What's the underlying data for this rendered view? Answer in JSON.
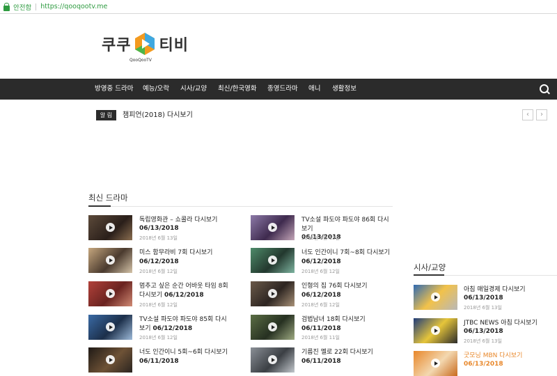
{
  "browser": {
    "secure_label": "안전함",
    "url": "https://qooqootv.me"
  },
  "logo": {
    "left": "쿠쿠",
    "right": "티비",
    "sub": "QooQooTV"
  },
  "nav": [
    "방영중 드라마",
    "예능/오락",
    "시사/교양",
    "최신/한국영화",
    "종영드라마",
    "애니",
    "생활정보"
  ],
  "notice": {
    "badge": "알 림",
    "text": "챔피언(2018) 다시보기",
    "prev": "‹",
    "next": "›"
  },
  "latest": {
    "title": "최신 드라마",
    "items": [
      {
        "title": "독립영화관 – 쇼콜라 다시보기",
        "date_bold": "06/13/2018",
        "date": "2018년 6월 13일"
      },
      {
        "title": "TV소설 파도야 파도야 86회 다시보기",
        "date_bold": "06/13/2018",
        "date": "2018년 6월 13일"
      },
      {
        "title": "미스 함무라비 7회 다시보기",
        "date_bold": "06/12/2018",
        "date": "2018년 6월 12일"
      },
      {
        "title": "너도 인간이니 7회~8회 다시보기",
        "date_bold": "06/12/2018",
        "date": "2018년 6월 12일"
      },
      {
        "title": "멈추고 싶은 순간 어바웃 타임 8회 다시보기",
        "date_bold": "06/12/2018",
        "date": "2018년 6월 12일"
      },
      {
        "title": "인형의 집 76회 다시보기",
        "date_bold": "06/12/2018",
        "date": "2018년 6월 12일"
      },
      {
        "title": "TV소설 파도야 파도야 85회 다시보기",
        "date_bold": "06/12/2018",
        "date": "2018년 6월 12일"
      },
      {
        "title": "검법남녀 18회 다시보기",
        "date_bold": "06/11/2018",
        "date": "2018년 6월 11일"
      },
      {
        "title": "너도 인간이니 5회~6회 다시보기",
        "date_bold": "06/11/2018",
        "date": ""
      },
      {
        "title": "기름진 멜로 22회 다시보기",
        "date_bold": "06/11/2018",
        "date": ""
      }
    ]
  },
  "sidebar": {
    "title": "시사/교양",
    "items": [
      {
        "title": "아침 매일경제 다시보기",
        "date_bold": "06/13/2018",
        "date": "2018년 6월 13일"
      },
      {
        "title": "JTBC NEWS 아침 다시보기",
        "date_bold": "06/13/2018",
        "date": "2018년 6월 13일"
      },
      {
        "title": "굿모닝 MBN 다시보기",
        "date_bold": "06/13/2018",
        "date": ""
      }
    ]
  }
}
